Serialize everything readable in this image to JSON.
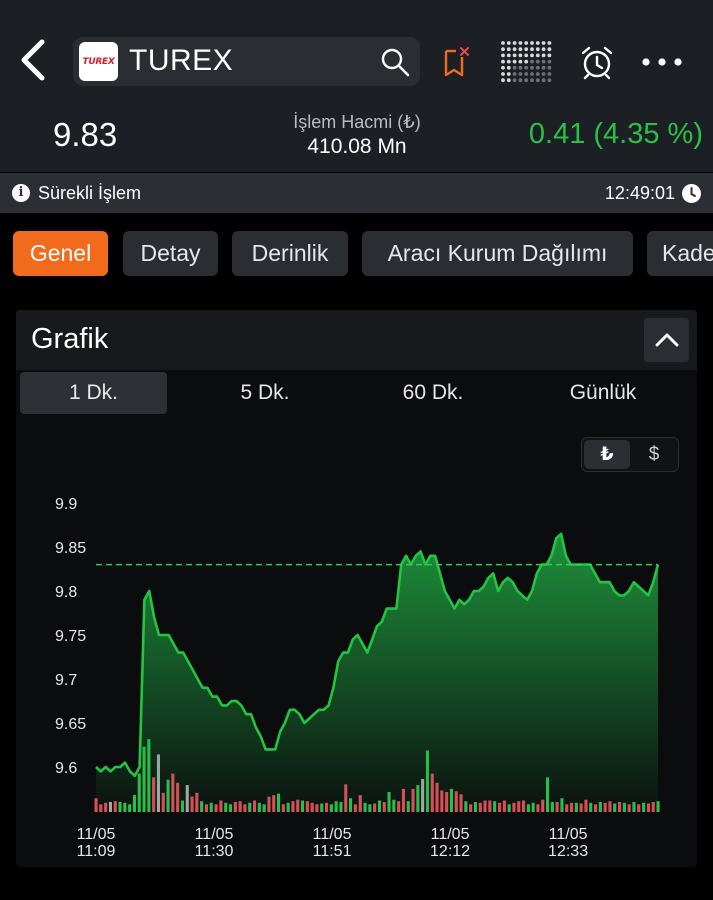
{
  "header": {
    "symbol": "TUREX",
    "logo_text": "TUREX",
    "icons": [
      "back-icon",
      "search-icon",
      "bookmark-remove-icon",
      "dot-grid-icon",
      "alarm-icon",
      "more-icon"
    ]
  },
  "quote": {
    "last_price": "9.83",
    "volume_label": "İşlem Hacmi (₺)",
    "volume_value": "410.08 Mn",
    "change": "0.41 (4.35 %)",
    "change_color": "#29c04a"
  },
  "status": {
    "session": "Sürekli İşlem",
    "time": "12:49:01"
  },
  "tabs": [
    {
      "label": "Genel",
      "active": true
    },
    {
      "label": "Detay",
      "active": false
    },
    {
      "label": "Derinlik",
      "active": false
    },
    {
      "label": "Aracı Kurum Dağılımı",
      "active": false
    },
    {
      "label": "Kademe",
      "active": false
    }
  ],
  "chart_card": {
    "title": "Grafik",
    "intervals": [
      {
        "label": "1 Dk.",
        "active": true
      },
      {
        "label": "5 Dk.",
        "active": false
      },
      {
        "label": "60 Dk.",
        "active": false
      },
      {
        "label": "Günlük",
        "active": false
      }
    ],
    "currency": {
      "try": "₺",
      "usd": "$",
      "selected": "₺"
    }
  },
  "colors": {
    "accent": "#f26a1b",
    "up": "#29c04a",
    "down": "#e5485a",
    "neutral_volume": "#a6a9ad"
  },
  "chart_data": {
    "type": "area",
    "title": "",
    "xlabel": "",
    "ylabel": "",
    "ylim": [
      9.55,
      9.9
    ],
    "yticks": [
      "9.9",
      "9.85",
      "9.8",
      "9.75",
      "9.7",
      "9.65",
      "9.6"
    ],
    "xticks": [
      {
        "date": "11/05",
        "time": "11:09"
      },
      {
        "date": "11/05",
        "time": "11:30"
      },
      {
        "date": "11/05",
        "time": "11:51"
      },
      {
        "date": "11/05",
        "time": "12:12"
      },
      {
        "date": "11/05",
        "time": "12:33"
      }
    ],
    "previous_close_line": 9.83,
    "x_start": "11:09",
    "x_end": "12:49",
    "series": [
      {
        "values": [
          9.6,
          9.595,
          9.6,
          9.595,
          9.6,
          9.6,
          9.605,
          9.595,
          9.59,
          9.6,
          9.79,
          9.8,
          9.77,
          9.75,
          9.75,
          9.75,
          9.74,
          9.73,
          9.73,
          9.72,
          9.71,
          9.7,
          9.69,
          9.69,
          9.68,
          9.68,
          9.67,
          9.67,
          9.675,
          9.675,
          9.67,
          9.66,
          9.66,
          9.645,
          9.635,
          9.62,
          9.62,
          9.62,
          9.64,
          9.65,
          9.665,
          9.665,
          9.66,
          9.65,
          9.655,
          9.66,
          9.665,
          9.665,
          9.67,
          9.69,
          9.72,
          9.73,
          9.73,
          9.745,
          9.75,
          9.74,
          9.73,
          9.745,
          9.76,
          9.765,
          9.78,
          9.78,
          9.78,
          9.83,
          9.84,
          9.83,
          9.84,
          9.845,
          9.83,
          9.84,
          9.84,
          9.82,
          9.8,
          9.79,
          9.78,
          9.79,
          9.785,
          9.79,
          9.8,
          9.8,
          9.805,
          9.815,
          9.82,
          9.8,
          9.81,
          9.815,
          9.81,
          9.8,
          9.795,
          9.79,
          9.8,
          9.82,
          9.83,
          9.83,
          9.84,
          9.86,
          9.865,
          9.84,
          9.83,
          9.83,
          9.83,
          9.83,
          9.83,
          9.82,
          9.81,
          9.81,
          9.81,
          9.8,
          9.795,
          9.795,
          9.8,
          9.81,
          9.805,
          9.8,
          9.795,
          9.81,
          9.83
        ]
      }
    ],
    "volume_series": {
      "values": [
        18,
        10,
        12,
        13,
        14,
        13,
        12,
        10,
        22,
        50,
        85,
        95,
        45,
        75,
        25,
        42,
        50,
        38,
        15,
        35,
        20,
        25,
        14,
        10,
        12,
        10,
        15,
        12,
        10,
        13,
        14,
        10,
        12,
        15,
        12,
        10,
        20,
        22,
        24,
        10,
        12,
        14,
        16,
        15,
        14,
        12,
        10,
        11,
        12,
        10,
        14,
        13,
        36,
        18,
        10,
        22,
        12,
        10,
        11,
        15,
        13,
        26,
        16,
        14,
        30,
        14,
        30,
        35,
        43,
        80,
        50,
        38,
        28,
        26,
        30,
        27,
        23,
        14,
        10,
        13,
        12,
        15,
        15,
        14,
        12,
        15,
        10,
        12,
        14,
        15,
        10,
        12,
        10,
        16,
        45,
        13,
        13,
        18,
        10,
        12,
        12,
        11,
        16,
        12,
        10,
        13,
        12,
        14,
        11,
        13,
        12,
        10,
        13,
        10,
        12,
        11,
        13,
        14
      ],
      "direction": [
        "d",
        "d",
        "d",
        "n",
        "d",
        "u",
        "u",
        "u",
        "u",
        "u",
        "u",
        "u",
        "d",
        "n",
        "d",
        "u",
        "d",
        "d",
        "u",
        "n",
        "d",
        "d",
        "u",
        "d",
        "u",
        "d",
        "d",
        "u",
        "u",
        "d",
        "d",
        "d",
        "u",
        "d",
        "u",
        "u",
        "d",
        "d",
        "u",
        "d",
        "u",
        "d",
        "d",
        "u",
        "d",
        "d",
        "d",
        "u",
        "d",
        "u",
        "u",
        "u",
        "d",
        "u",
        "d",
        "d",
        "u",
        "u",
        "d",
        "u",
        "d",
        "u",
        "u",
        "d",
        "d",
        "u",
        "d",
        "u",
        "n",
        "u",
        "d",
        "d",
        "d",
        "d",
        "u",
        "d",
        "d",
        "u",
        "d",
        "u",
        "d",
        "d",
        "d",
        "u",
        "d",
        "d",
        "u",
        "d",
        "d",
        "d",
        "u",
        "u",
        "d",
        "d",
        "u",
        "u",
        "d",
        "u",
        "d",
        "d",
        "u",
        "d",
        "d",
        "u",
        "d",
        "u",
        "d",
        "d",
        "u",
        "d",
        "u",
        "d",
        "u",
        "d",
        "u",
        "d",
        "d",
        "u"
      ]
    }
  }
}
